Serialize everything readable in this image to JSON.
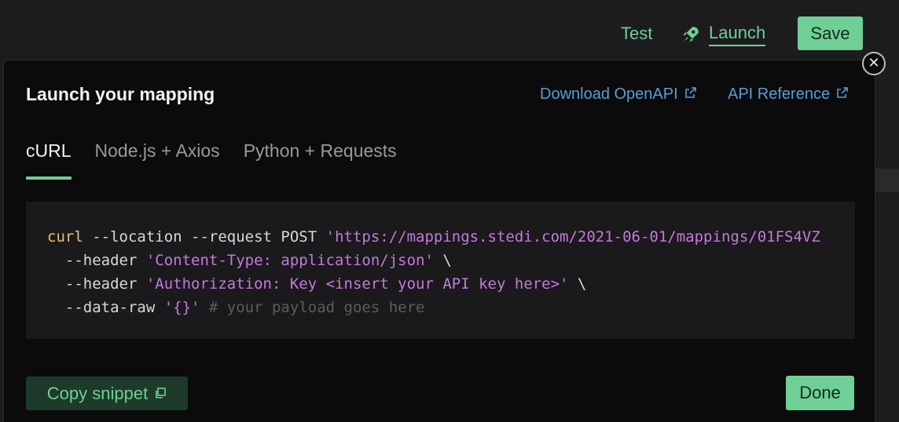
{
  "topbar": {
    "test_label": "Test",
    "launch_label": "Launch",
    "save_label": "Save"
  },
  "modal": {
    "title": "Launch your mapping",
    "links": [
      {
        "label": "Download OpenAPI",
        "icon": "external-link-icon"
      },
      {
        "label": "API Reference",
        "icon": "external-link-icon"
      }
    ],
    "tabs": [
      {
        "label": "cURL",
        "active": true
      },
      {
        "label": "Node.js + Axios",
        "active": false
      },
      {
        "label": "Python + Requests",
        "active": false
      }
    ],
    "code": {
      "line1_cmd": "curl",
      "line1_opts": " --location --request POST ",
      "line1_url": "'https://mappings.stedi.com/2021-06-01/mappings/01FS4VZ",
      "line2_opt": "  --header ",
      "line2_val": "'Content-Type: application/json'",
      "line2_end": " \\",
      "line3_opt": "  --header ",
      "line3_val": "'Authorization: Key <insert your API key here>'",
      "line3_end": " \\",
      "line4_opt": "  --data-raw ",
      "line4_val": "'{}'",
      "line4_comment": " # your payload goes here"
    },
    "copy_label": "Copy snippet",
    "done_label": "Done",
    "close_icon": "close-icon"
  },
  "colors": {
    "accent": "#6fcf97",
    "link": "#5b9bd5",
    "string": "#c678dd",
    "keyword": "#e6c07b"
  }
}
